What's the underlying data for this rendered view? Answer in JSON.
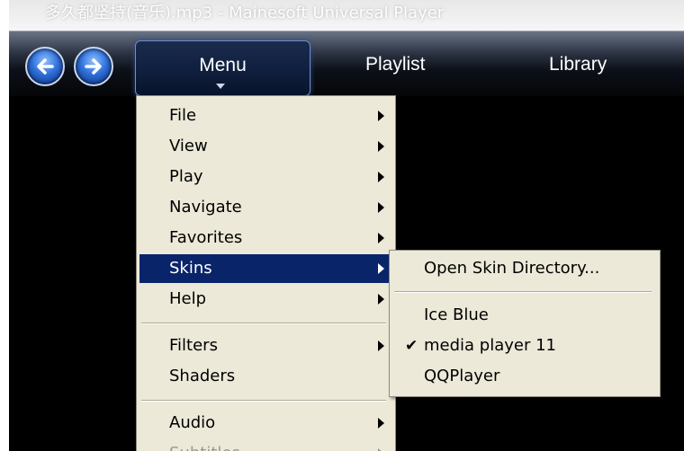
{
  "window": {
    "title": "多久都坚持(音乐).mp3 - Mainesoft Universal Player"
  },
  "toolbar": {
    "menu_label": "Menu",
    "tabs": [
      {
        "label": "Playlist"
      },
      {
        "label": "Library"
      }
    ]
  },
  "menu": {
    "items": [
      {
        "label": "File",
        "submenu": true
      },
      {
        "label": "View",
        "submenu": true
      },
      {
        "label": "Play",
        "submenu": true
      },
      {
        "label": "Navigate",
        "submenu": true
      },
      {
        "label": "Favorites",
        "submenu": true
      },
      {
        "label": "Skins",
        "submenu": true,
        "highlighted": true
      },
      {
        "label": "Help",
        "submenu": true
      },
      {
        "label": "Filters",
        "submenu": true
      },
      {
        "label": "Shaders",
        "submenu": false
      },
      {
        "label": "Audio",
        "submenu": true
      },
      {
        "label": "Subtitles",
        "submenu": true
      }
    ]
  },
  "skins_submenu": {
    "open_dir": "Open Skin Directory...",
    "skins": [
      {
        "label": "Ice Blue",
        "checked": false
      },
      {
        "label": "media player 11",
        "checked": true
      },
      {
        "label": "QQPlayer",
        "checked": false
      }
    ],
    "check_glyph": "✔"
  },
  "colors": {
    "menu_bg": "#ece9d8",
    "highlight": "#0a246a"
  }
}
